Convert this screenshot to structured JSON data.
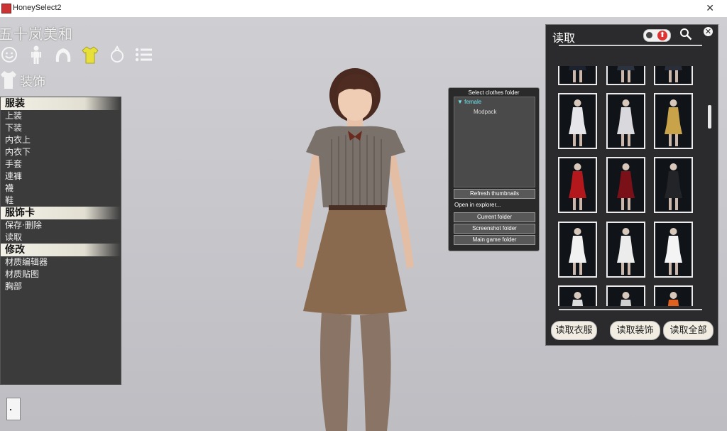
{
  "window": {
    "title": "HoneySelect2",
    "close_glyph": "✕"
  },
  "character": {
    "name": "五十岚美和"
  },
  "category_icons": [
    "face-icon",
    "body-icon",
    "hair-icon",
    "clothes-icon",
    "accessory-icon",
    "list-icon"
  ],
  "section": {
    "icon": "shirt-icon",
    "label": "装饰"
  },
  "left_menu": {
    "groups": [
      {
        "label": "服装",
        "items": [
          "上装",
          "下装",
          "内衣上",
          "内衣下",
          "手套",
          "連褲",
          "襪",
          "鞋"
        ]
      },
      {
        "label": "服饰卡",
        "items": [
          "保存·删除",
          "读取"
        ]
      },
      {
        "label": "修改",
        "items": [
          "材质编辑器",
          "材质贴图",
          "胸部"
        ]
      }
    ]
  },
  "folder_panel": {
    "title": "Select clothes folder",
    "tree": {
      "selected": "female",
      "selected_icon": "folder-open-icon",
      "child": "Modpack"
    },
    "refresh": "Refresh thumbnails",
    "open_in": "Open in explorer...",
    "buttons": [
      "Current folder",
      "Screenshot folder",
      "Main game folder"
    ]
  },
  "load_panel": {
    "title": "读取",
    "toggle_arrow": "⬆",
    "close_glyph": "✕",
    "buttons": [
      "读取衣服",
      "读取装饰",
      "读取全部"
    ],
    "thumbnail_outfits": [
      {
        "color": "#1c2230"
      },
      {
        "color": "#2b3240"
      },
      {
        "color": "#2a2d3a"
      },
      {
        "color": "#e6e6ea"
      },
      {
        "color": "#d9d9dd"
      },
      {
        "color": "#c9a34a"
      },
      {
        "color": "#b3191c"
      },
      {
        "color": "#7a1018"
      },
      {
        "color": "#222428"
      },
      {
        "color": "#f1f1f1"
      },
      {
        "color": "#ececec"
      },
      {
        "color": "#f4f4f4"
      },
      {
        "color": "#dcdcdc"
      },
      {
        "color": "#d0d0d0"
      },
      {
        "color": "#e06020"
      }
    ]
  }
}
